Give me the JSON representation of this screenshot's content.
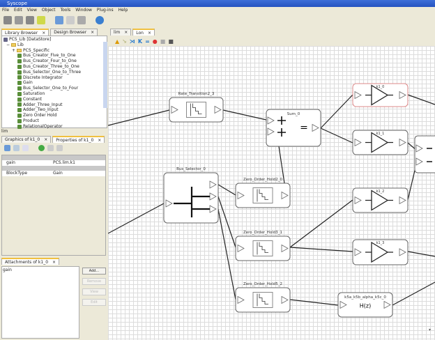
{
  "window": {
    "title": "Syscope"
  },
  "menu": [
    "File",
    "Edit",
    "View",
    "Object",
    "Tools",
    "Window",
    "Plug-ins",
    "Help"
  ],
  "left_tabs": [
    "Library Browser",
    "Design Browser"
  ],
  "tree": {
    "root": "PCS_Lib [DataStore]",
    "lib": "Lib",
    "folder": "PCS_Specific",
    "items": [
      "Bus_Creator_Five_to_One",
      "Bus_Creator_Four_to_One",
      "Bus_Creator_Three_to_One",
      "Bus_Selector_One_to_Three",
      "Discrete Integrator",
      "Gain",
      "Bus_Selector_One_to_Four",
      "Saturation",
      "Constant",
      "Adder_Three_Input",
      "Adder_Two_Input",
      "Zero Order Hold",
      "Product",
      "RelationalOperator"
    ]
  },
  "status_left": "lim",
  "props_tabs": [
    "Graphics of k1_0",
    "Properties of k1_0"
  ],
  "props": [
    {
      "name": "gain",
      "value": "PCS.lim.k1"
    },
    {
      "name": "BlockType",
      "value": "Gain"
    }
  ],
  "attach": {
    "tab": "Attachments of k1_0",
    "items": [
      "gain"
    ],
    "buttons": [
      "Add...",
      "Remove",
      "View",
      "Edit"
    ]
  },
  "editor_tabs": [
    "lim",
    "Lon"
  ],
  "blocks": {
    "rt": "Rate_Transition2_3",
    "sum": "Sum_0",
    "sum_eq": "=",
    "bs": "Bus_Selector_0",
    "z2": "Zero_Order_Hold2_0",
    "z3": "Zero_Order_Hold3_1",
    "z5": "Zero_Order_Hold5_2",
    "k0": "k1_0",
    "k1": "k1_1",
    "k2": "k1_2",
    "k3": "k1_3",
    "tf": "k5a_k5b_alpha_k5c_0",
    "tf_expr": "H(z)"
  }
}
